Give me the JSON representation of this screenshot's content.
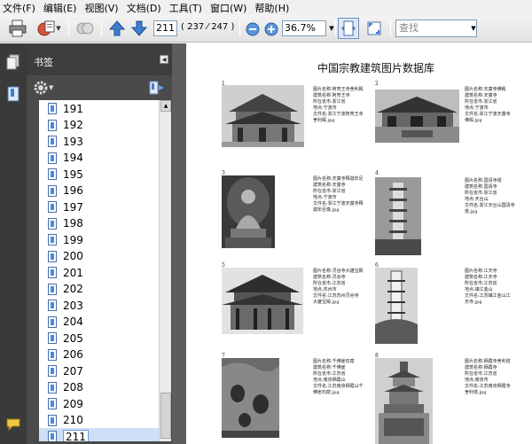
{
  "menu": [
    {
      "label": "文件(F)"
    },
    {
      "label": "编辑(E)"
    },
    {
      "label": "视图(V)"
    },
    {
      "label": "文档(D)"
    },
    {
      "label": "工具(T)"
    },
    {
      "label": "窗口(W)"
    },
    {
      "label": "帮助(H)"
    }
  ],
  "toolbar": {
    "page_input": "211",
    "page_count": "( 237 ⁄ 247 )",
    "zoom": "36.7%",
    "search_placeholder": "查找"
  },
  "bookmarks": {
    "title": "书签",
    "items": [
      "191",
      "192",
      "193",
      "194",
      "195",
      "196",
      "197",
      "198",
      "199",
      "200",
      "201",
      "202",
      "203",
      "204",
      "205",
      "206",
      "207",
      "208",
      "209",
      "210",
      "211"
    ],
    "selected": "211"
  },
  "document": {
    "title": "中国宗教建筑图片数据库",
    "entries": [
      {
        "num": "1",
        "caption": [
          "图片名称:阿育王寺舍利殿",
          "建筑名称:阿育王寺",
          "所在省市:浙江省",
          "地点:宁波市",
          "文件名:浙江宁波阿育王寺",
          "舍利殿.jpg"
        ]
      },
      {
        "num": "2",
        "caption": [
          "图片名称:天童寺佛殿",
          "建筑名称:天童寺",
          "所在省市:浙江省",
          "地点:宁波市",
          "文件名:浙江宁波天童寺",
          "佛殿.jpg"
        ]
      },
      {
        "num": "3",
        "caption": [
          "图片名称:天童寺释迦牟尼",
          "建筑名称:天童寺",
          "所在省市:浙江省",
          "地点:宁波市",
          "文件名:浙江宁波天童寺释",
          "迦牟尼像.jpg"
        ]
      },
      {
        "num": "4",
        "caption": [
          "图片名称:国清寺塔",
          "建筑名称:国清寺",
          "所在省市:浙江省",
          "地点:天台山",
          "文件名:浙江天台山国清寺",
          "塔.jpg"
        ]
      },
      {
        "num": "5",
        "caption": [
          "图片名称:灵谷寺大雄宝殿",
          "建筑名称:灵谷寺",
          "所在省市:江苏省",
          "地点:苏州市",
          "文件名:江苏苏州灵谷寺",
          "大雄宝殿.jpg"
        ]
      },
      {
        "num": "6",
        "caption": [
          "图片名称:江天寺",
          "建筑名称:江天寺",
          "所在省市:江苏省",
          "地点:镇江金山",
          "文件名:江苏镇江金山江",
          "天寺.jpg"
        ]
      },
      {
        "num": "7",
        "caption": [
          "图片名称:千佛崖石窟",
          "建筑名称:千佛崖",
          "所在省市:江苏省",
          "地点:南京栖霞山",
          "文件名:江苏南京栖霞山千",
          "佛崖石窟.jpg"
        ]
      },
      {
        "num": "8",
        "caption": [
          "图片名称:栖霞寺舍利塔",
          "建筑名称:栖霞寺",
          "所在省市:江苏省",
          "地点:南京市",
          "文件名:江苏南京栖霞寺",
          "舍利塔.jpg"
        ]
      }
    ]
  }
}
